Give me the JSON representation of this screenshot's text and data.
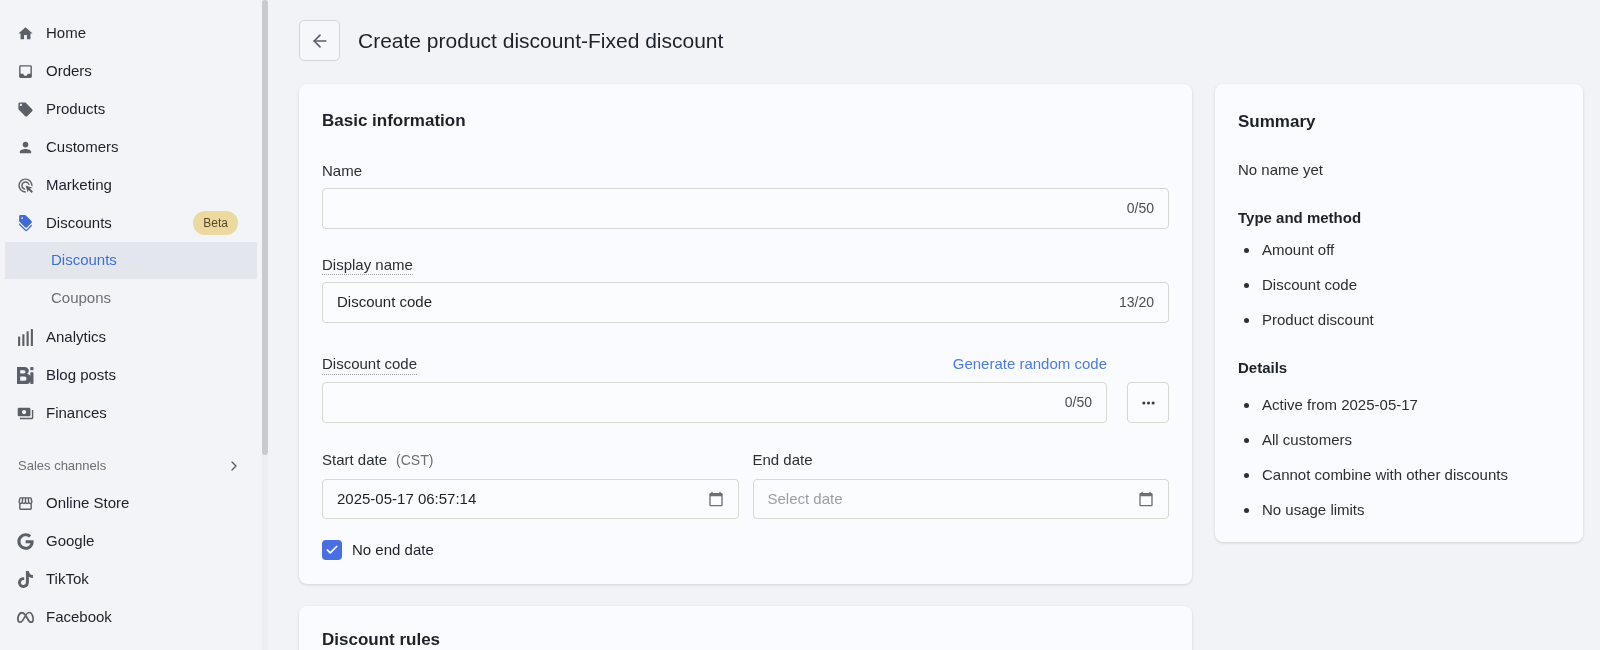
{
  "sidebar": {
    "nav_items": [
      {
        "label": "Home",
        "selected": false
      },
      {
        "label": "Orders",
        "selected": false
      },
      {
        "label": "Products",
        "selected": false
      },
      {
        "label": "Customers",
        "selected": false
      },
      {
        "label": "Marketing",
        "selected": false
      },
      {
        "label": "Discounts",
        "selected": true,
        "badge": "Beta",
        "expanded": true,
        "children": [
          {
            "label": "Discounts",
            "selected": true
          },
          {
            "label": "Coupons",
            "selected": false
          }
        ]
      },
      {
        "label": "Analytics",
        "selected": false
      },
      {
        "label": "Blog posts",
        "selected": false
      },
      {
        "label": "Finances",
        "selected": false
      }
    ],
    "sales_channels": {
      "title": "Sales channels",
      "items": [
        {
          "label": "Online Store",
          "selected": false
        },
        {
          "label": "Google",
          "selected": false
        },
        {
          "label": "TikTok",
          "selected": false
        },
        {
          "label": "Facebook",
          "selected": false
        }
      ]
    }
  },
  "page": {
    "title": "Create product discount-Fixed discount"
  },
  "basic_information": {
    "title": "Basic information",
    "name": {
      "label": "Name",
      "counter": "0/50"
    },
    "display_name": {
      "label": "Display name",
      "value": "Discount code",
      "counter": "13/20"
    },
    "discount_code": {
      "label": "Discount code",
      "link": "Generate random code",
      "counter": "0/50"
    },
    "start_date": {
      "label": "Start date",
      "timezone": "(CST)",
      "value": "2025-05-17 06:57:14"
    },
    "end_date": {
      "label": "End date",
      "placeholder": "Select date"
    },
    "no_end_date": {
      "label": "No end date",
      "checked": true
    }
  },
  "discount_rules": {
    "title": "Discount rules"
  },
  "summary": {
    "title": "Summary",
    "name": "No name yet",
    "sections": [
      {
        "title": "Type and method",
        "items": [
          "Amount off",
          "Discount code",
          "Product discount"
        ]
      },
      {
        "title": "Details",
        "items": [
          "Active from 2025-05-17",
          "All customers",
          "Cannot combine with other discounts",
          "No usage limits"
        ]
      }
    ]
  }
}
